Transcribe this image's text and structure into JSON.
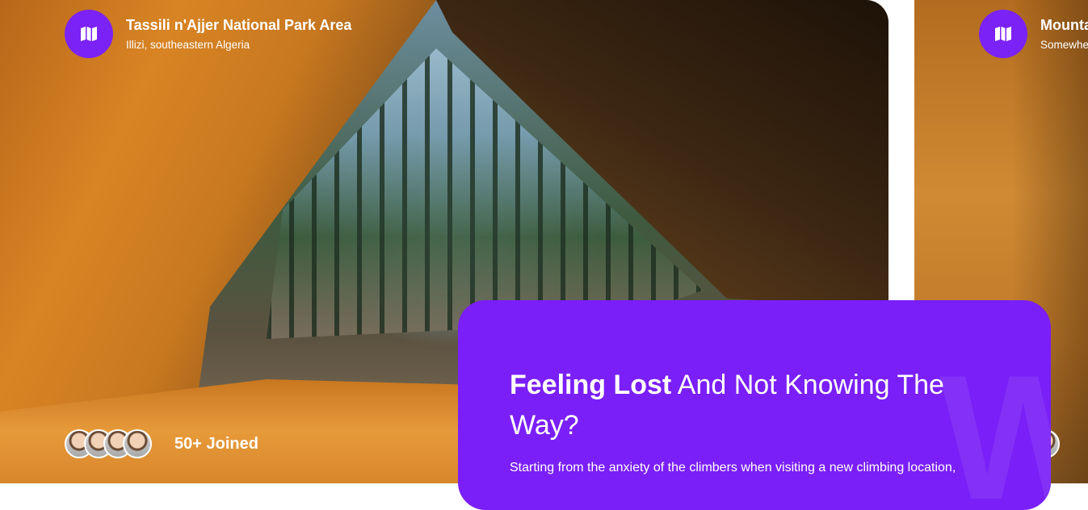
{
  "main_card": {
    "location_title": "Tassili n'Ajjer National Park Area",
    "location_subtitle": "Illizi, southeastern Algeria",
    "joined_label": "50+ Joined",
    "icon": "map-icon"
  },
  "next_card": {
    "location_title": "Mounta",
    "location_subtitle": "Somewhe",
    "icon": "map-icon"
  },
  "promo": {
    "heading_strong": "Feeling Lost",
    "heading_rest": " And Not Knowing The Way?",
    "body": "Starting from the anxiety of the climbers when visiting a new climbing location,",
    "watermark": "W"
  },
  "colors": {
    "accent": "#7a1ff7",
    "icon_bg": "#7b22f6",
    "text": "#ffffff"
  }
}
